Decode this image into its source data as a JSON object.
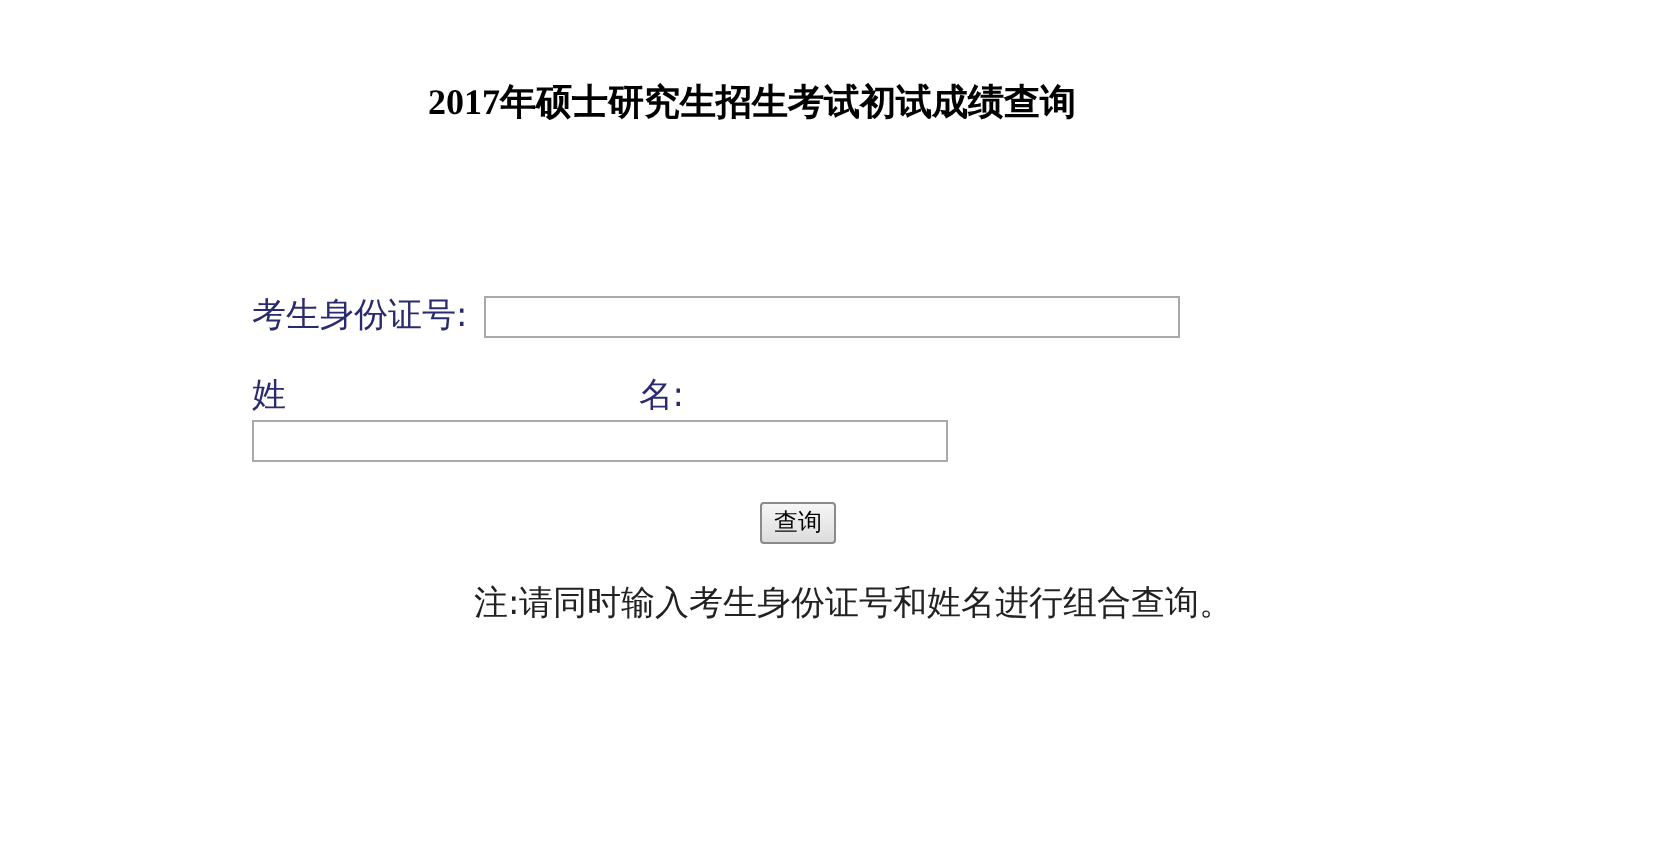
{
  "title": "2017年硕士研究生招生考试初试成绩查询",
  "id_field": {
    "label": "考生身份证号:"
  },
  "name_field": {
    "label_parts": [
      "姓",
      "名:"
    ]
  },
  "submit_button": {
    "label": "查询"
  },
  "note": "注:请同时输入考生身份证号和姓名进行组合查询。"
}
